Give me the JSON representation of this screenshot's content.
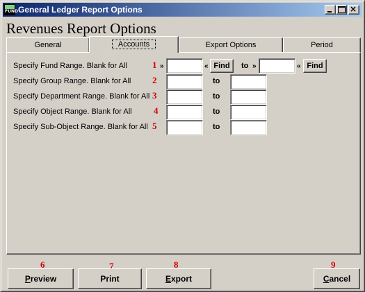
{
  "window": {
    "title": "General Ledger Report Options",
    "icon_text": "FUND",
    "close_glyph": "×"
  },
  "page_title": "Revenues Report Options",
  "tabs": [
    {
      "label": "General"
    },
    {
      "label": "Accounts",
      "active": true
    },
    {
      "label": "Export Options"
    },
    {
      "label": "Period"
    }
  ],
  "rows": [
    {
      "label": "Specify Fund Range. Blank for All",
      "marker": "1",
      "from_value": "",
      "to_value": ""
    },
    {
      "label": "Specify Group Range. Blank for All",
      "marker": "2",
      "from_value": "",
      "to_value": ""
    },
    {
      "label": "Specify Department Range. Blank for All",
      "marker": "3",
      "from_value": "",
      "to_value": ""
    },
    {
      "label": "Specify Object Range. Blank for All",
      "marker": "4",
      "from_value": "",
      "to_value": ""
    },
    {
      "label": "Specify Sub-Object Range. Blank for All",
      "marker": "5",
      "from_value": "",
      "to_value": ""
    }
  ],
  "to_label": "to",
  "guillemet_right": "»",
  "guillemet_left": "«",
  "find_label": "Find",
  "buttons": [
    {
      "marker": "6",
      "underline": "P",
      "rest": "review"
    },
    {
      "marker": "7",
      "underline": "",
      "rest": "Print"
    },
    {
      "marker": "8",
      "underline": "E",
      "rest": "xport"
    },
    {
      "marker": "9",
      "underline": "C",
      "rest": "ancel"
    }
  ],
  "colors": {
    "title_bar": "#0a246a",
    "marker": "#d40000",
    "face": "#d4d0c8"
  }
}
